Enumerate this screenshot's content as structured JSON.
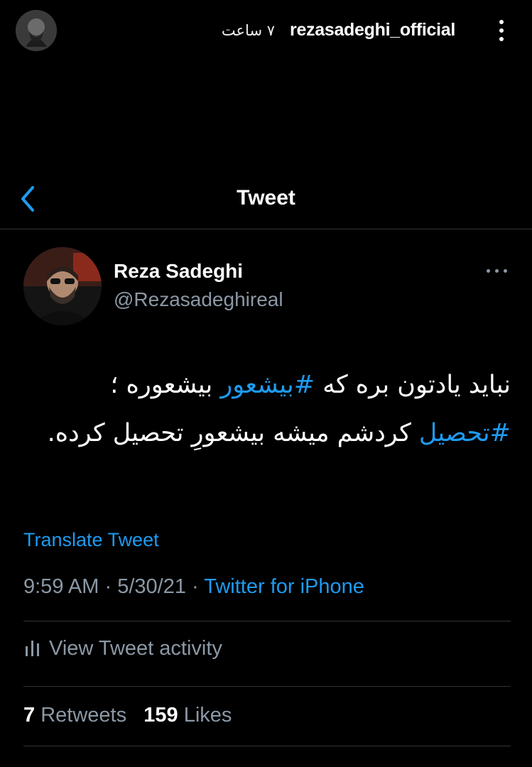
{
  "story": {
    "username": "rezasadeghi_official",
    "time_ago": "۷ ساعت",
    "avatar_icon": "profile-photo-icon",
    "more_icon": "vertical-ellipsis-icon"
  },
  "tweet_nav": {
    "back_icon": "chevron-left-icon",
    "title": "Tweet"
  },
  "author": {
    "name": "Reza Sadeghi",
    "handle": "@Rezasadeghireal",
    "more_icon": "horizontal-ellipsis-icon"
  },
  "tweet": {
    "text_part1": "نباید یادتون بره که ",
    "hashtag1": "#بیشعور",
    "text_part2": " بیشعوره ؛ ",
    "hashtag2": "#تحصیل",
    "text_part3": " کردشم میشه بیشعورِ تحصیل کرده.",
    "translate_label": "Translate Tweet",
    "time": "9:59 AM",
    "date": "5/30/21",
    "separator": "·",
    "source": "Twitter for iPhone",
    "activity_label": "View Tweet activity",
    "activity_icon": "bar-chart-icon"
  },
  "stats": {
    "retweets_count": "7",
    "retweets_label": "Retweets",
    "likes_count": "159",
    "likes_label": "Likes"
  },
  "colors": {
    "background": "#000000",
    "accent": "#1d9bf0",
    "secondary_text": "#8b98a5",
    "divider": "#2f3336"
  }
}
